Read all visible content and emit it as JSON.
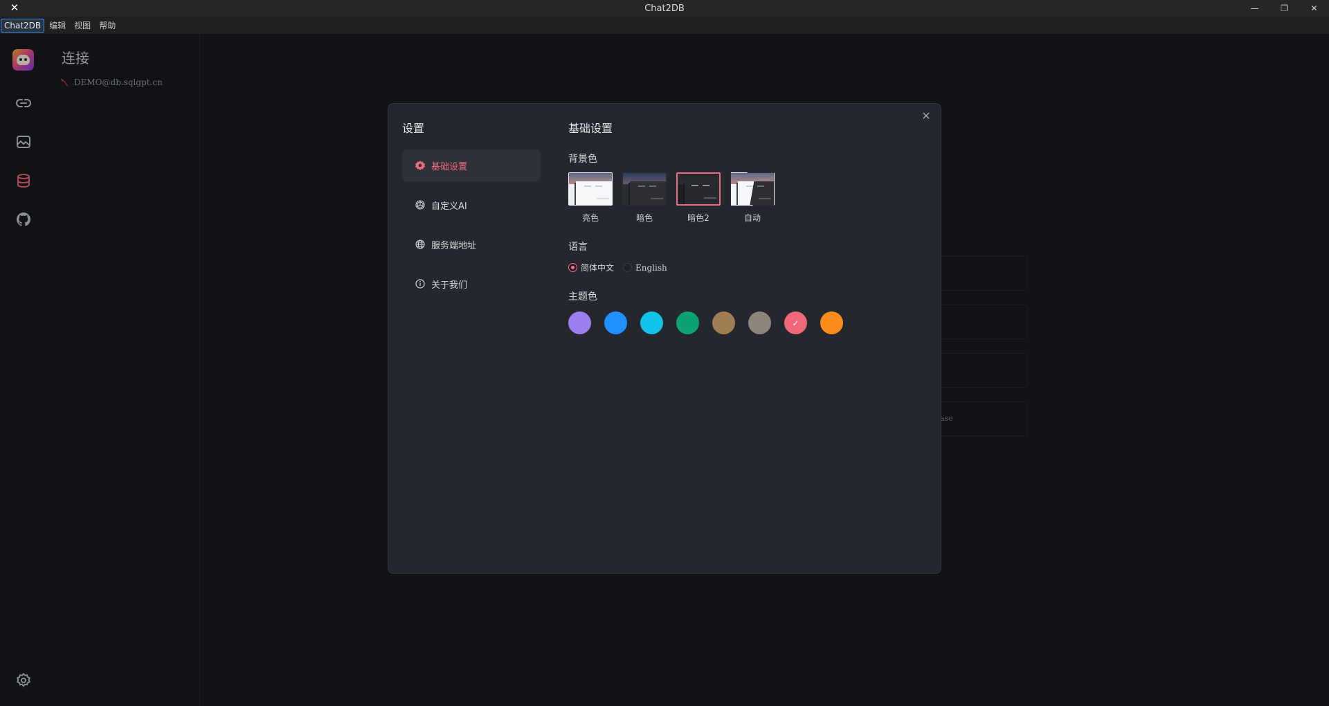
{
  "window": {
    "title": "Chat2DB"
  },
  "menu": [
    "Chat2DB",
    "编辑",
    "视图",
    "帮助"
  ],
  "connections": {
    "heading": "连接",
    "items": [
      {
        "label": "DEMO@db.sqlgpt.cn"
      }
    ]
  },
  "background_ghost_text": "ase",
  "settings": {
    "title": "设置",
    "nav": [
      {
        "label": "基础设置",
        "icon": "gear-icon",
        "active": true
      },
      {
        "label": "自定义AI",
        "icon": "openai-icon"
      },
      {
        "label": "服务端地址",
        "icon": "globe-icon"
      },
      {
        "label": "关于我们",
        "icon": "info-icon"
      }
    ],
    "basic": {
      "title": "基础设置",
      "background_label": "背景色",
      "backgrounds": [
        {
          "label": "亮色",
          "selected": false
        },
        {
          "label": "暗色",
          "selected": false
        },
        {
          "label": "暗色2",
          "selected": true
        },
        {
          "label": "自动",
          "selected": false
        }
      ],
      "language_label": "语言",
      "languages": [
        {
          "label": "简体中文",
          "checked": true
        },
        {
          "label": "English",
          "checked": false
        }
      ],
      "theme_label": "主题色",
      "theme_colors": [
        "#9c7ef0",
        "#1e90ff",
        "#13c2e8",
        "#0ca272",
        "#a07d55",
        "#8d847b",
        "#f0677a",
        "#fb8c1b"
      ],
      "theme_selected_index": 6
    }
  }
}
